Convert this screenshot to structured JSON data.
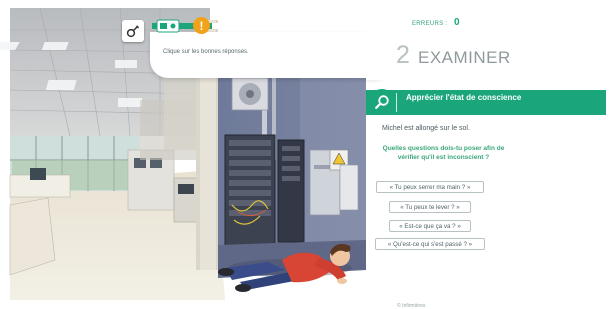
{
  "toolbar": {
    "tool_icon": "gear-icon",
    "step_flag_icon": "flag-icon",
    "alert": "!",
    "alert_icon": "exclamation-icon"
  },
  "progress": {
    "fraction": 0.25
  },
  "instruction": {
    "text": "Clique sur les bonnes réponses."
  },
  "panel": {
    "errors_label": "ERREURS :",
    "errors_count": "0",
    "step_number": "2",
    "step_title": "EXAMINER",
    "section_title": "Apprécier l'état de conscience",
    "statement": "Michel est allongé sur le sol.",
    "question": "Quelles questions dois-tu poser afin de vérifier qu'il est inconscient ?",
    "options": [
      "« Tu peux serrer ma main ? »",
      "« Tu peux te lever ? »",
      "« Est-ce que ça va ? »",
      "« Qu'est-ce qui s'est passé ? »"
    ],
    "copyright": "© Infirmières"
  },
  "colors": {
    "accent": "#1aa57b",
    "alert": "#f0a21a",
    "panel_bg": "#ffffff",
    "question_green": "#3aa77a"
  }
}
